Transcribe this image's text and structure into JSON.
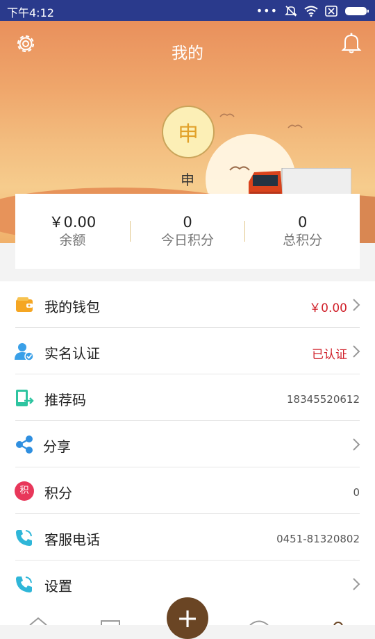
{
  "status_bar": {
    "time": "下午4:12",
    "icons": [
      "dots-icon",
      "mute-icon",
      "wifi-icon",
      "sim-icon",
      "battery-icon"
    ]
  },
  "header": {
    "title": "我的",
    "settings_icon": "gear-icon",
    "notification_icon": "bell-icon"
  },
  "profile": {
    "avatar_text": "申",
    "name": "申"
  },
  "stats": [
    {
      "value": "￥0.00",
      "label": "余额"
    },
    {
      "value": "0",
      "label": "今日积分"
    },
    {
      "value": "0",
      "label": "总积分"
    }
  ],
  "menu": [
    {
      "label": "我的钱包",
      "value": "￥0.00",
      "icon": "wallet-icon",
      "chevron": true
    },
    {
      "label": "实名认证",
      "value": "已认证",
      "icon": "verify-user-icon",
      "chevron": true
    },
    {
      "label": "推荐码",
      "value": "18345520612",
      "icon": "referral-icon",
      "chevron": false
    },
    {
      "label": "分享",
      "value": "",
      "icon": "share-icon",
      "chevron": true
    },
    {
      "label": "积分",
      "value": "0",
      "icon": "points-icon",
      "chevron": false
    },
    {
      "label": "客服电话",
      "value": "0451-81320802",
      "icon": "phone-icon",
      "chevron": false
    },
    {
      "label": "设置",
      "value": "",
      "icon": "settings-phone-icon",
      "chevron": true
    }
  ],
  "points_badge": "积",
  "fab": {
    "label": "+"
  },
  "colors": {
    "status_bar": "#2a3a8c",
    "accent_red": "#d0202a",
    "fab": "#6a4524"
  }
}
